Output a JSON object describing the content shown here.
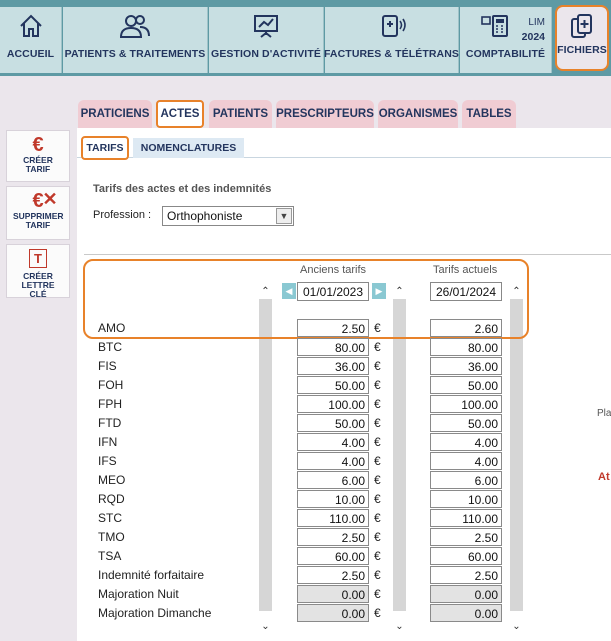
{
  "nav": {
    "accueil": "ACCUEIL",
    "patients": "PATIENTS & TRAITEMENTS",
    "gestion": "GESTION D'ACTIVITÉ",
    "factures": "FACTURES & TÉLÉTRANS",
    "comptabilite": "COMPTABILITÉ",
    "lim": "LIM",
    "year": "2024",
    "fichiers": "FICHIERS"
  },
  "sidebar": {
    "creer_tarif": "CRÉER TARIF",
    "supprimer_tarif": "SUPPRIMER TARIF",
    "creer_lettre": "CRÉER LETTRE CLÉ"
  },
  "tabs": [
    "PRATICIENS",
    "ACTES",
    "PATIENTS",
    "PRESCRIPTEURS",
    "ORGANISMES",
    "TABLES"
  ],
  "subtabs": [
    "TARIFS",
    "NOMENCLATURES"
  ],
  "content": {
    "title": "Tarifs des actes et des indemnités",
    "profession_label": "Profession :",
    "profession_value": "Orthophoniste",
    "old_header": "Anciens tarifs",
    "new_header": "Tarifs actuels",
    "old_date": "01/01/2023",
    "new_date": "26/01/2024",
    "currency": "€",
    "edge_text_1": "Pla",
    "edge_text_2": "At"
  },
  "rows": [
    {
      "label": "AMO",
      "old": "2.50",
      "new": "2.60"
    },
    {
      "label": "BTC",
      "old": "80.00",
      "new": "80.00"
    },
    {
      "label": "FIS",
      "old": "36.00",
      "new": "36.00"
    },
    {
      "label": "FOH",
      "old": "50.00",
      "new": "50.00"
    },
    {
      "label": "FPH",
      "old": "100.00",
      "new": "100.00"
    },
    {
      "label": "FTD",
      "old": "50.00",
      "new": "50.00"
    },
    {
      "label": "IFN",
      "old": "4.00",
      "new": "4.00"
    },
    {
      "label": "IFS",
      "old": "4.00",
      "new": "4.00"
    },
    {
      "label": "MEO",
      "old": "6.00",
      "new": "6.00"
    },
    {
      "label": "RQD",
      "old": "10.00",
      "new": "10.00"
    },
    {
      "label": "STC",
      "old": "110.00",
      "new": "110.00"
    },
    {
      "label": "TMO",
      "old": "2.50",
      "new": "2.50"
    },
    {
      "label": "TSA",
      "old": "60.00",
      "new": "60.00"
    },
    {
      "label": "Indemnité forfaitaire",
      "old": "2.50",
      "new": "2.50"
    },
    {
      "label": "Majoration Nuit",
      "old": "0.00",
      "new": "0.00",
      "disabled": true
    },
    {
      "label": "Majoration Dimanche",
      "old": "0.00",
      "new": "0.00",
      "disabled": true
    }
  ],
  "colors": {
    "accent": "#e8822a",
    "nav_bg": "#5e9aa4",
    "nav_btn": "#c8dfe2",
    "tab_pink": "#f0ccd3",
    "text_navy": "#23355e"
  }
}
